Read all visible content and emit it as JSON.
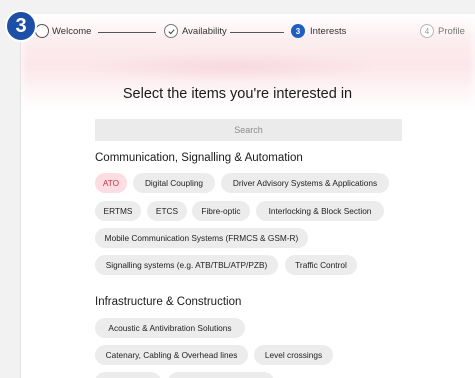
{
  "badge": {
    "number": "3"
  },
  "stepper": {
    "steps": [
      {
        "label": "Welcome",
        "state": "done"
      },
      {
        "label": "Availability",
        "state": "done"
      },
      {
        "label": "Interests",
        "state": "current",
        "number": "3"
      },
      {
        "label": "Profile",
        "state": "upcoming",
        "number": "4"
      }
    ]
  },
  "heading": "Select the items you're interested in",
  "search": {
    "placeholder": "Search"
  },
  "sections": [
    {
      "title": "Communication, Signalling & Automation",
      "chips": [
        {
          "label": "ATO",
          "selected": true
        },
        {
          "label": "Digital Coupling",
          "selected": false
        },
        {
          "label": "Driver Advisory Systems & Applications",
          "selected": false
        },
        {
          "label": "ERTMS",
          "selected": false
        },
        {
          "label": "ETCS",
          "selected": false
        },
        {
          "label": "Fibre-optic",
          "selected": false
        },
        {
          "label": "Interlocking & Block Section",
          "selected": false
        },
        {
          "label": "Mobile Communication Systems (FRMCS & GSM-R)",
          "selected": false
        },
        {
          "label": "Signalling systems (e.g. ATB/TBL/ATP/PZB)",
          "selected": false
        },
        {
          "label": "Traffic Control",
          "selected": false
        }
      ]
    },
    {
      "title": "Infrastructure & Construction",
      "chips": [
        {
          "label": "Acoustic & Antivibration Solutions",
          "selected": false
        },
        {
          "label": "Catenary, Cabling & Overhead lines",
          "selected": false
        },
        {
          "label": "Level crossings",
          "selected": false
        }
      ]
    }
  ],
  "colors": {
    "accent": "#1f5fbf",
    "badge": "#1c4fa5",
    "chip_bg": "#ececec",
    "chip_selected_bg": "#fbdde2",
    "chip_selected_text": "#c7344d"
  }
}
